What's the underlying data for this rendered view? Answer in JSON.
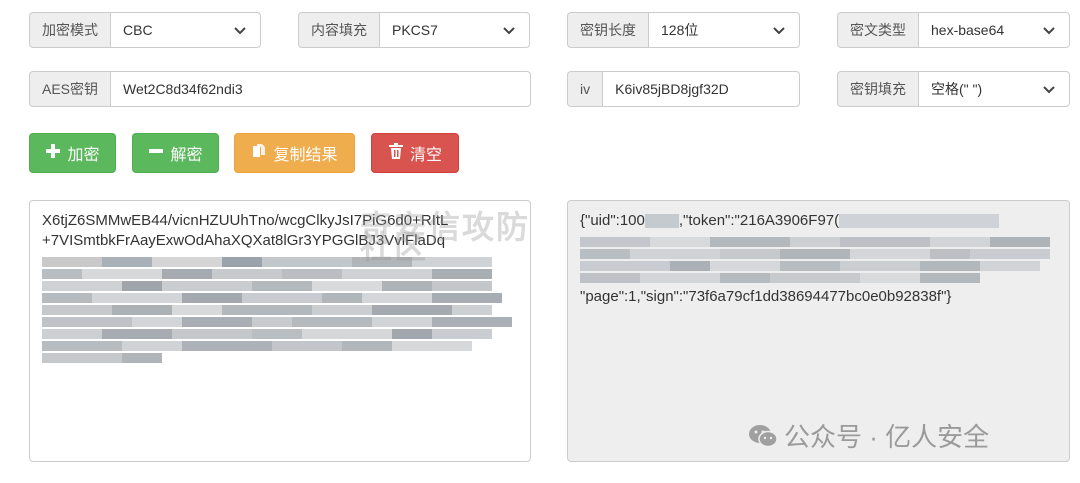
{
  "row1": {
    "mode": {
      "label": "加密模式",
      "value": "CBC"
    },
    "padding": {
      "label": "内容填充",
      "value": "PKCS7"
    },
    "key_length": {
      "label": "密钥长度",
      "value": "128位"
    },
    "cipher_type": {
      "label": "密文类型",
      "value": "hex-base64"
    }
  },
  "row2": {
    "aes_key": {
      "label": "AES密钥",
      "value": "Wet2C8d34f62ndi3"
    },
    "iv": {
      "label": "iv",
      "value": "K6iv85jBD8jgf32D"
    },
    "key_fill": {
      "label": "密钥填充",
      "value": "空格(\" \")"
    }
  },
  "buttons": {
    "encrypt": "加密",
    "decrypt": "解密",
    "copy": "复制结果",
    "clear": "清空"
  },
  "input_text": {
    "line1": "X6tjZ6SMMwEB44/vicnHZUUhTno/wcgClkyJsI7PiG6d0+RItL",
    "line2": "+7VISmtbkFrAayExwOdAhaXQXat8lGr3YPGGlBJ3VvlFlaDq"
  },
  "output_text": {
    "line1_a": "{\"uid\":100",
    "line1_b": ",\"token\":\"216A3906F97(",
    "last": "\"page\":1,\"sign\":\"73f6a79cf1dd38694477bc0e0b92838f\"}"
  },
  "watermark": {
    "center": "奇安信攻防社区",
    "corner": "公众号 · 亿人安全"
  },
  "colors": {
    "green": "#5cb85c",
    "orange": "#f0ad4e",
    "red": "#d9534f",
    "addon_bg": "#eeeeee",
    "output_bg": "#eeeeee"
  }
}
